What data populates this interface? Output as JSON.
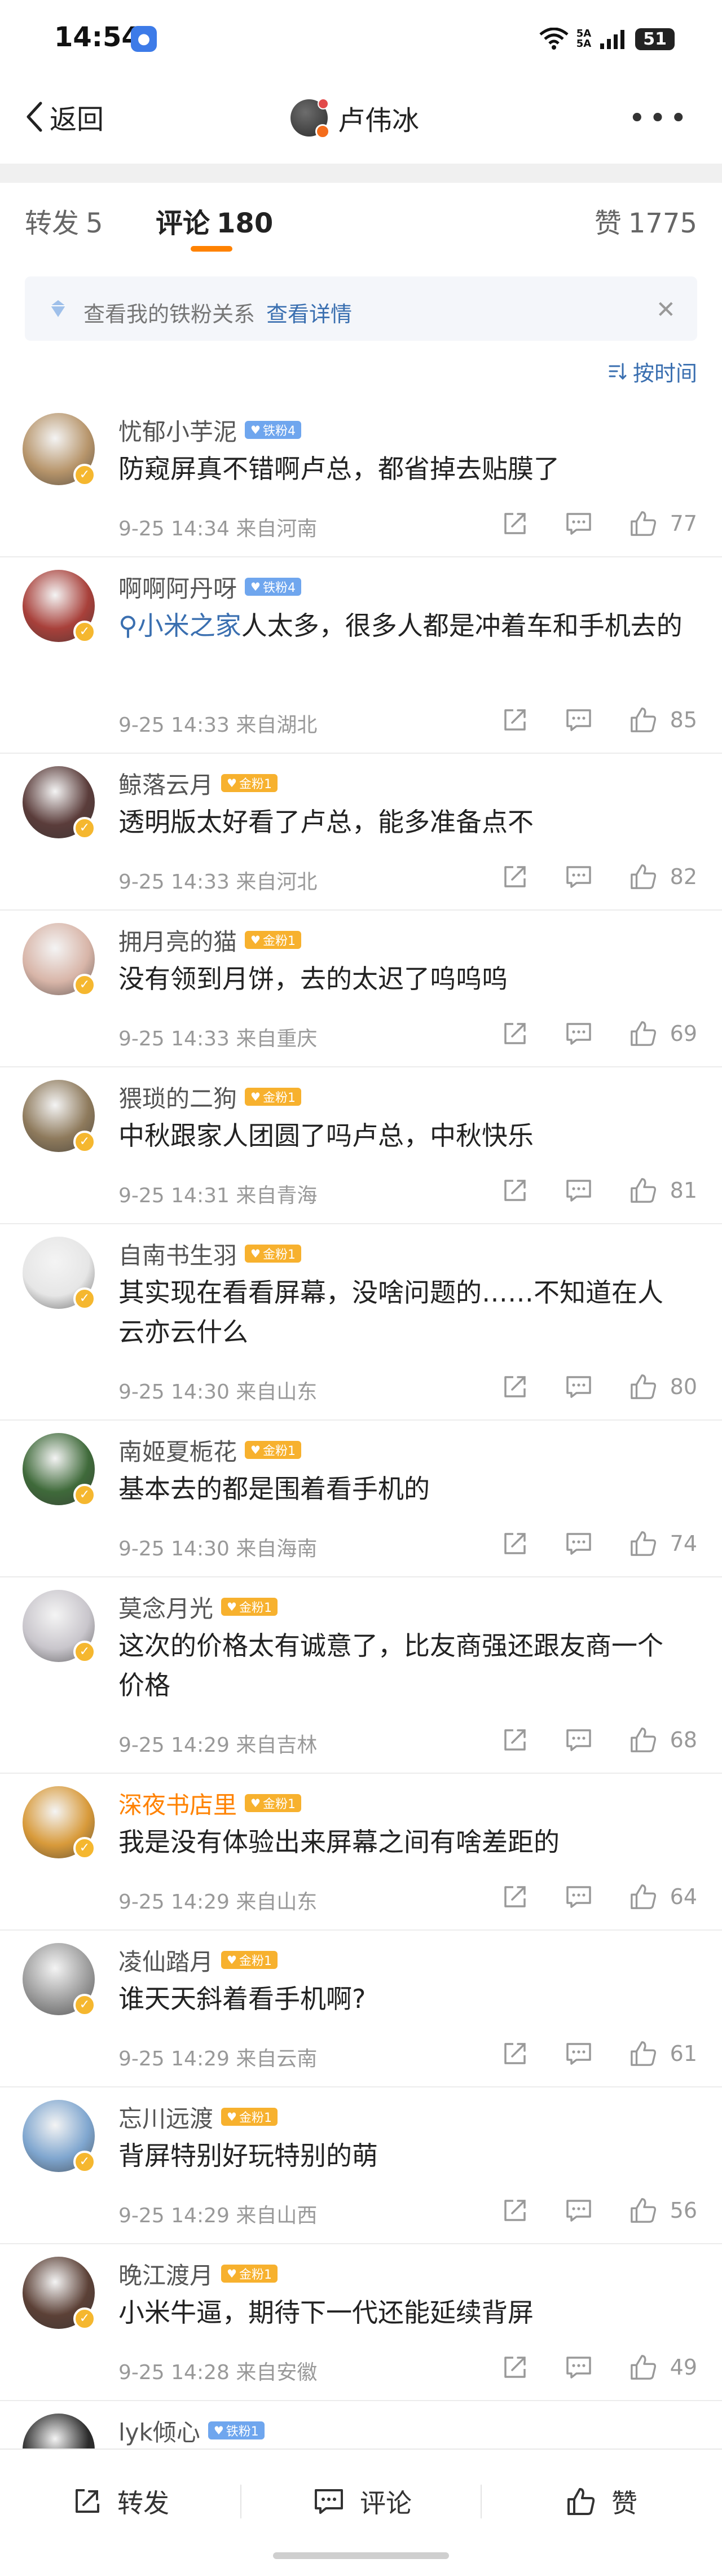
{
  "status_bar": {
    "time": "14:54",
    "network": [
      "5A",
      "5A"
    ],
    "battery": "51"
  },
  "nav": {
    "back_label": "返回",
    "title": "卢伟冰"
  },
  "tabs": {
    "repost": {
      "label": "转发",
      "count": "5"
    },
    "comment": {
      "label": "评论",
      "count": "180"
    },
    "like": {
      "label": "赞",
      "count": "1775"
    }
  },
  "notice": {
    "text": "查看我的铁粉关系",
    "link": "查看详情"
  },
  "sort_label": "按时间",
  "comments": [
    {
      "name": "忧郁小芋泥",
      "badge": "铁粉4",
      "badge_type": "iron",
      "text": "防窥屏真不错啊卢总，都省掉去贴膜了",
      "time": "9-25 14:34",
      "location": "来自河南",
      "likes": "77",
      "avatar_color": "#b7956b"
    },
    {
      "name": "啊啊阿丹呀",
      "badge": "铁粉4",
      "badge_type": "iron",
      "tag": "小米之家",
      "text": "人太多，很多人都是冲着车和手机去的",
      "time": "9-25 14:33",
      "location": "来自湖北",
      "likes": "85",
      "avatar_color": "#a8403a"
    },
    {
      "name": "鲸落云月",
      "badge": "金粉1",
      "badge_type": "gold",
      "text": "透明版太好看了卢总，能多准备点不",
      "time": "9-25 14:33",
      "location": "来自河北",
      "likes": "82",
      "avatar_color": "#5a3c3a"
    },
    {
      "name": "拥月亮的猫",
      "badge": "金粉1",
      "badge_type": "gold",
      "text": "没有领到月饼，去的太迟了呜呜呜",
      "time": "9-25 14:33",
      "location": "来自重庆",
      "likes": "69",
      "avatar_color": "#d8b5a8"
    },
    {
      "name": "猥琐的二狗",
      "badge": "金粉1",
      "badge_type": "gold",
      "text": "中秋跟家人团圆了吗卢总，中秋快乐",
      "time": "9-25 14:31",
      "location": "来自青海",
      "likes": "81",
      "avatar_color": "#8e7a5c"
    },
    {
      "name": "自南书生羽",
      "badge": "金粉1",
      "badge_type": "gold",
      "text": "其实现在看看屏幕，没啥问题的……不知道在人云亦云什么",
      "time": "9-25 14:30",
      "location": "来自山东",
      "likes": "80",
      "avatar_color": "#e6e6e6"
    },
    {
      "name": "南姬夏栀花",
      "badge": "金粉1",
      "badge_type": "gold",
      "text": "基本去的都是围着看手机的",
      "time": "9-25 14:30",
      "location": "来自海南",
      "likes": "74",
      "avatar_color": "#3f6a3a"
    },
    {
      "name": "莫念月光",
      "badge": "金粉1",
      "badge_type": "gold",
      "text": "这次的价格太有诚意了，比友商强还跟友商一个价格",
      "time": "9-25 14:29",
      "location": "来自吉林",
      "likes": "68",
      "avatar_color": "#c9c6cc"
    },
    {
      "name": "深夜书店里",
      "badge": "金粉1",
      "badge_type": "gold",
      "orange": true,
      "text": "我是没有体验出来屏幕之间有啥差距的",
      "time": "9-25 14:29",
      "location": "来自山东",
      "likes": "64",
      "avatar_color": "#d89a3a"
    },
    {
      "name": "凌仙踏月",
      "badge": "金粉1",
      "badge_type": "gold",
      "text": "谁天天斜着看手机啊?",
      "time": "9-25 14:29",
      "location": "来自云南",
      "likes": "61",
      "avatar_color": "#9c9c9c"
    },
    {
      "name": "忘川远渡",
      "badge": "金粉1",
      "badge_type": "gold",
      "text": "背屏特别好玩特别的萌",
      "time": "9-25 14:29",
      "location": "来自山西",
      "likes": "56",
      "avatar_color": "#7fa6cf"
    },
    {
      "name": "晚江渡月",
      "badge": "金粉1",
      "badge_type": "gold",
      "text": "小米牛逼，期待下一代还能延续背屏",
      "time": "9-25 14:28",
      "location": "来自安徽",
      "likes": "49",
      "avatar_color": "#5b4036"
    },
    {
      "name": "lyk倾心",
      "badge": "铁粉1",
      "badge_type": "iron",
      "text": "",
      "time": "",
      "location": "",
      "likes": "",
      "avatar_color": "#2a2a2a"
    }
  ],
  "bottom_bar": {
    "repost": "转发",
    "comment": "评论",
    "like": "赞"
  }
}
